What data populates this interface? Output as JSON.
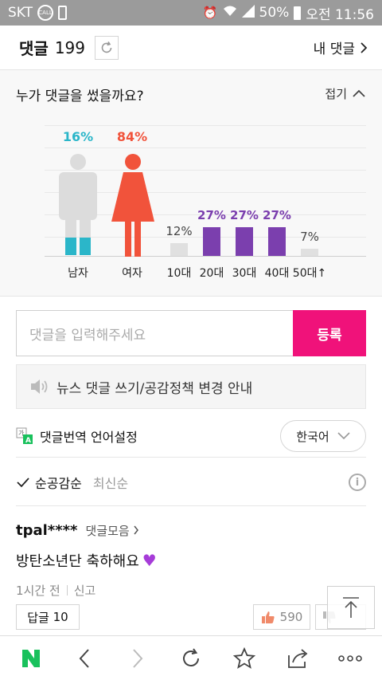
{
  "status_bar": {
    "carrier": "SKT",
    "battery": "50%",
    "time": "오전 11:56"
  },
  "header": {
    "title": "댓글",
    "count": "199",
    "my_comments": "내 댓글"
  },
  "stats": {
    "question": "누가 댓글을 썼을까요?",
    "fold_label": "접기",
    "male_color": "#2bb6c9",
    "female_color": "#f1533b",
    "age_color": "#7b3fae",
    "age_low_color": "#e0e0e0"
  },
  "chart_data": {
    "type": "bar",
    "gender": {
      "categories": [
        "남자",
        "여자"
      ],
      "values": [
        16,
        84
      ],
      "labels": [
        "16%",
        "84%"
      ]
    },
    "age": {
      "categories": [
        "10대",
        "20대",
        "30대",
        "40대",
        "50대↑"
      ],
      "values": [
        12,
        27,
        27,
        27,
        7
      ],
      "labels": [
        "12%",
        "27%",
        "27%",
        "27%",
        "7%"
      ]
    }
  },
  "input": {
    "placeholder": "댓글을 입력해주세요",
    "submit_label": "등록"
  },
  "notice": {
    "text": "뉴스 댓글 쓰기/공감정책 변경 안내"
  },
  "translate": {
    "label": "댓글번역 언어설정",
    "language": "한국어"
  },
  "sort": {
    "active": "순공감순",
    "other": "최신순"
  },
  "comment": {
    "user": "tpal****",
    "collection": "댓글모음",
    "text": "방탄소년단 축하해요",
    "time": "1시간 전",
    "report": "신고",
    "reply_label": "답글",
    "reply_count": "10",
    "likes": "590"
  }
}
